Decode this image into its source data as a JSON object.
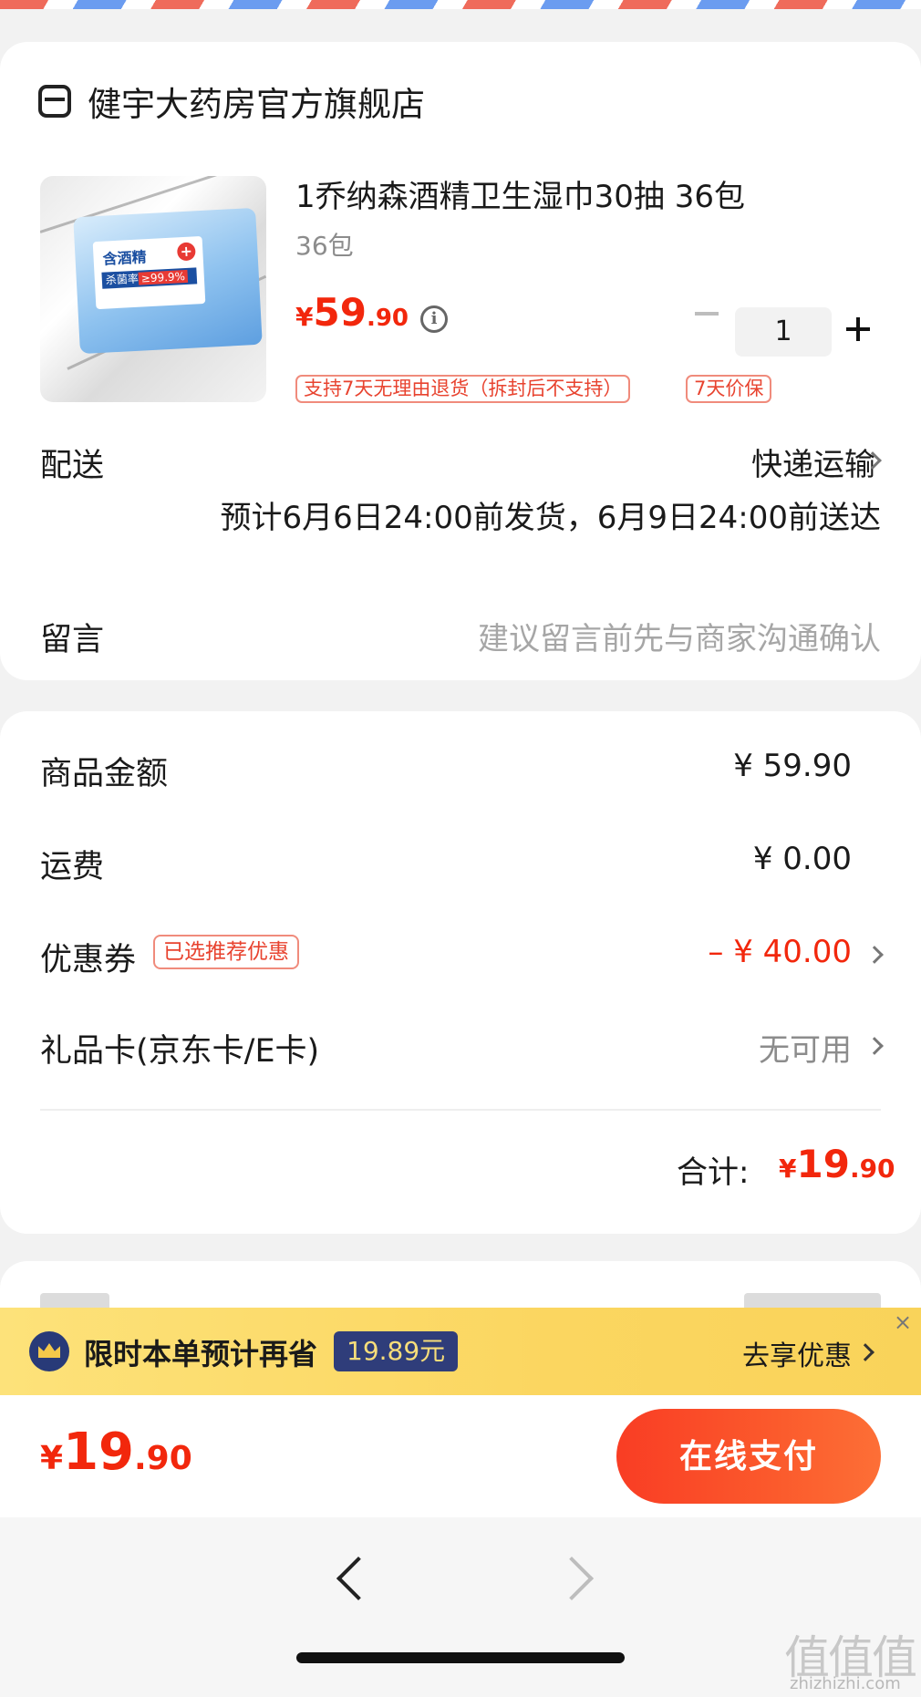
{
  "store": {
    "name": "健宇大药房官方旗舰店",
    "icon": "store-icon"
  },
  "product": {
    "title": "1乔纳森酒精卫生湿巾30抽 36包",
    "spec": "36包",
    "price": {
      "currency": "¥",
      "integer": "59",
      "decimal": ".90"
    },
    "image": {
      "label_title": "含酒精",
      "label_cross": "+",
      "label_rate": "杀菌率",
      "label_rate_value": "≥99.9%"
    },
    "quantity": "1",
    "tags": [
      "支持7天无理由退货（拆封后不支持）",
      "7天价保"
    ]
  },
  "shipping": {
    "label": "配送",
    "method": "快递运输",
    "estimate": "预计6月6日24:00前发货，6月9日24:00前送达"
  },
  "message": {
    "label": "留言",
    "placeholder": "建议留言前先与商家沟通确认"
  },
  "summary": {
    "goods_label": "商品金额",
    "goods_value": "¥ 59.90",
    "freight_label": "运费",
    "freight_value": "¥ 0.00",
    "coupon_label": "优惠券",
    "coupon_tag": "已选推荐优惠",
    "coupon_value": "– ¥ 40.00",
    "giftcard_label": "礼品卡(京东卡/E卡)",
    "giftcard_value": "无可用",
    "total_label": "合计:",
    "total": {
      "currency": "¥",
      "integer": "19",
      "decimal": ".90"
    }
  },
  "promo": {
    "text": "限时本单预计再省",
    "badge": "19.89元",
    "link": "去享优惠",
    "close": "×"
  },
  "paybar": {
    "price": {
      "currency": "¥",
      "integer": "19",
      "decimal": ".90"
    },
    "button": "在线支付"
  },
  "watermark": {
    "mark": "值值值",
    "text": "zhizhizhi.com"
  },
  "colors": {
    "accent": "#f2270c",
    "promo_bg": "#fbd660",
    "promo_badge": "#2f3d7a"
  }
}
